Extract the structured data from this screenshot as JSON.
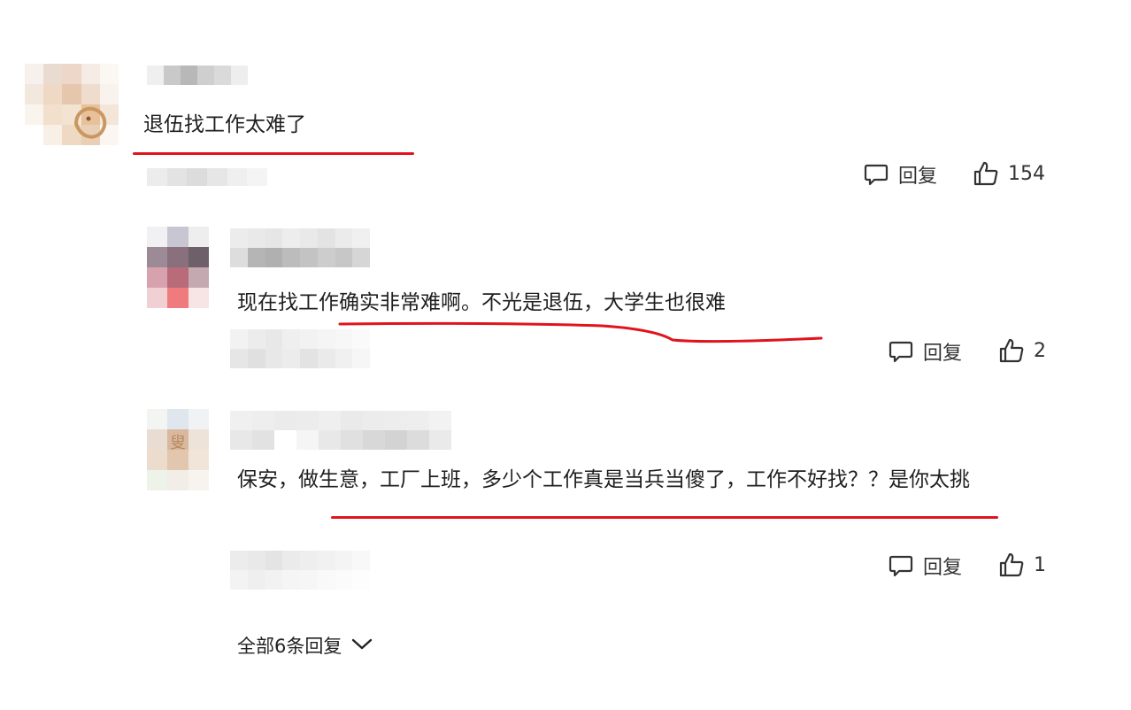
{
  "comments": [
    {
      "text": "退伍找工作太难了",
      "reply_label": "回复",
      "like_count": "154"
    },
    {
      "text": "现在找工作确实非常难啊。不光是退伍，大学生也很难",
      "reply_label": "回复",
      "like_count": "2"
    },
    {
      "text": "保安，做生意，工厂上班，多少个工作真是当兵当傻了，工作不好找？？是你太挑",
      "reply_label": "回复",
      "like_count": "1"
    }
  ],
  "more_replies_label": "全部6条回复",
  "icons": {
    "reply": "comment-bubble-icon",
    "like": "thumbs-up-icon",
    "expand": "chevron-down-icon"
  },
  "colors": {
    "underline": "#e0141e",
    "text": "#1f1f1f",
    "mosaic": "#d9d9d9"
  }
}
